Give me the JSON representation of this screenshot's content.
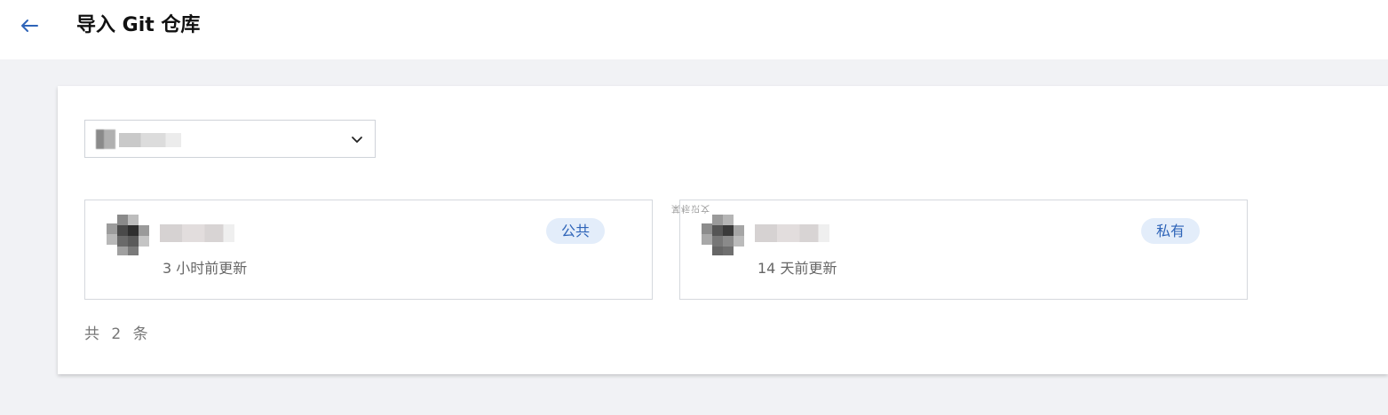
{
  "header": {
    "title": "导入 Git 仓库",
    "back_icon": "arrow-left-icon"
  },
  "account_select": {
    "selected_value": "",
    "icon": "chevron-down-icon"
  },
  "repos": [
    {
      "name": "",
      "updated": "3 小时前更新",
      "visibility": "公共"
    },
    {
      "name": "",
      "updated": "14 天前更新",
      "visibility": "私有"
    }
  ],
  "watermark_text": "某标识文",
  "pagination": {
    "total_text": "共 2 条"
  },
  "colors": {
    "accent": "#2e64b8",
    "badge_bg": "#e3edfa",
    "page_bg": "#f1f2f5"
  }
}
